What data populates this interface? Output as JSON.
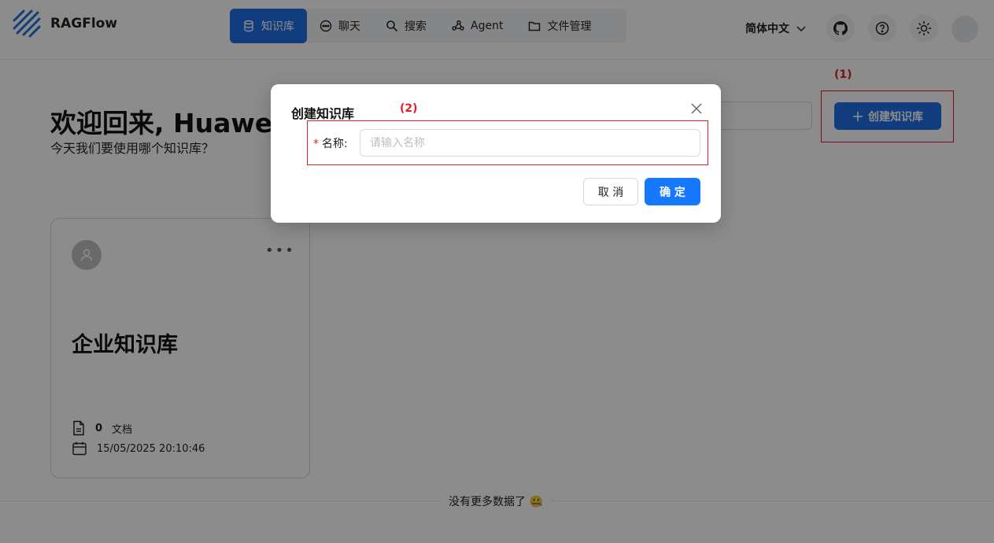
{
  "header": {
    "brand": "RAGFlow",
    "nav": [
      {
        "label": "知识库",
        "icon": "database-icon",
        "active": true
      },
      {
        "label": "聊天",
        "icon": "chat-icon",
        "active": false
      },
      {
        "label": "搜索",
        "icon": "search-icon",
        "active": false
      },
      {
        "label": "Agent",
        "icon": "agent-icon",
        "active": false
      },
      {
        "label": "文件管理",
        "icon": "folder-icon",
        "active": false
      }
    ],
    "language": "简体中文"
  },
  "main": {
    "welcome": "欢迎回来, Huawei",
    "subtitle": "今天我们要使用哪个知识库？",
    "create_button": "创建知识库",
    "annotation_1": "(1)"
  },
  "card": {
    "name": "企业知识库",
    "doc_count": "0",
    "doc_label": "文档",
    "date": "15/05/2025 20:10:46"
  },
  "footer": {
    "text": "没有更多数据了 🤐"
  },
  "modal": {
    "title": "创建知识库",
    "annotation_2": "(2)",
    "field_required": "*",
    "field_label": "名称:",
    "field_placeholder": "请输入名称",
    "field_value": "",
    "cancel": "取 消",
    "ok": "确 定"
  },
  "colors": {
    "primary": "#1f6fe6",
    "modal_primary": "#1677ff",
    "annotation": "#e11d2a"
  }
}
